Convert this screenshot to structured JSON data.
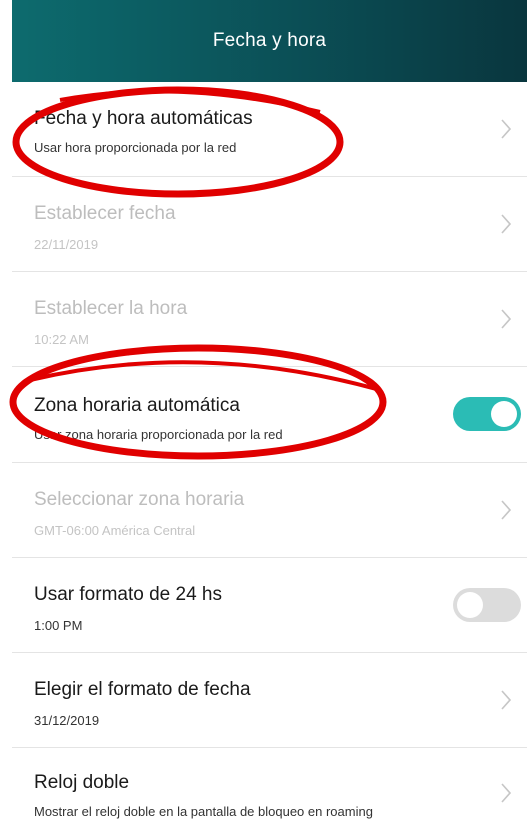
{
  "header": {
    "title": "Fecha y hora"
  },
  "rows": [
    {
      "title": "Fecha y hora automáticas",
      "subtitle": "Usar hora proporcionada por la red",
      "control": "chevron",
      "disabled": false
    },
    {
      "title": "Establecer fecha",
      "subtitle": "22/11/2019",
      "control": "chevron",
      "disabled": true
    },
    {
      "title": "Establecer la hora",
      "subtitle": "10:22 AM",
      "control": "chevron",
      "disabled": true
    },
    {
      "title": "Zona horaria automática",
      "subtitle": "Usar zona horaria proporcionada por la red",
      "control": "toggle",
      "toggle_on": true,
      "disabled": false
    },
    {
      "title": "Seleccionar zona horaria",
      "subtitle": "GMT-06:00 América Central",
      "control": "chevron",
      "disabled": true
    },
    {
      "title": "Usar formato de 24 hs",
      "subtitle": "1:00 PM",
      "control": "toggle",
      "toggle_on": false,
      "disabled": false
    },
    {
      "title": "Elegir el formato de fecha",
      "subtitle": "31/12/2019",
      "control": "chevron",
      "disabled": false
    },
    {
      "title": "Reloj doble",
      "subtitle": "Mostrar el reloj doble en la pantalla de bloqueo en roaming",
      "control": "chevron",
      "disabled": false
    }
  ],
  "colors": {
    "header_start": "#0d6b6e",
    "header_end": "#09363e",
    "toggle_on": "#2bbcb5",
    "toggle_off": "#dcdcdc",
    "annotation": "#e00000"
  },
  "icons": {
    "chevron": "chevron-right-icon"
  }
}
